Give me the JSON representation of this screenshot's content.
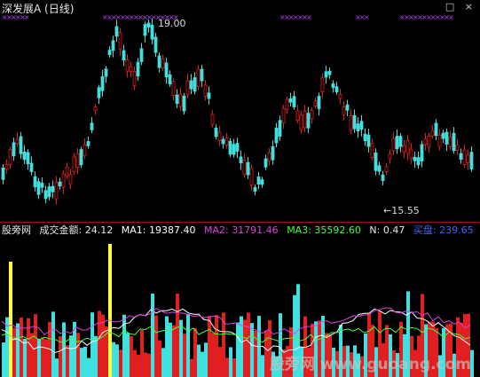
{
  "header": {
    "title": "深发展A (日线)",
    "window_icons": "□ ×"
  },
  "price_chart": {
    "high_label": "19.00",
    "low_label": "←15.55",
    "high_value": 19.0,
    "low_value": 15.55,
    "colors": {
      "up": "#e02020",
      "down": "#40e0e0",
      "marker": "#c040ff"
    }
  },
  "indicator": {
    "site": "股旁网",
    "name": "成交金额:",
    "value": "24.12",
    "ma1_label": "MA1:",
    "ma1_value": "19387.40",
    "ma2_label": "MA2:",
    "ma2_value": "31791.46",
    "ma3_label": "MA3:",
    "ma3_value": "35592.60",
    "n_label": "N:",
    "n_value": "0.47",
    "buy_label": "买盘:",
    "buy_value": "239.65",
    "colors": {
      "ma1": "#ffffff",
      "ma2": "#e040e0",
      "ma3": "#40ff40",
      "buy": "#4040ff",
      "highlight": "#ffff40"
    }
  },
  "watermark": "股旁网 www.guoang.com"
}
